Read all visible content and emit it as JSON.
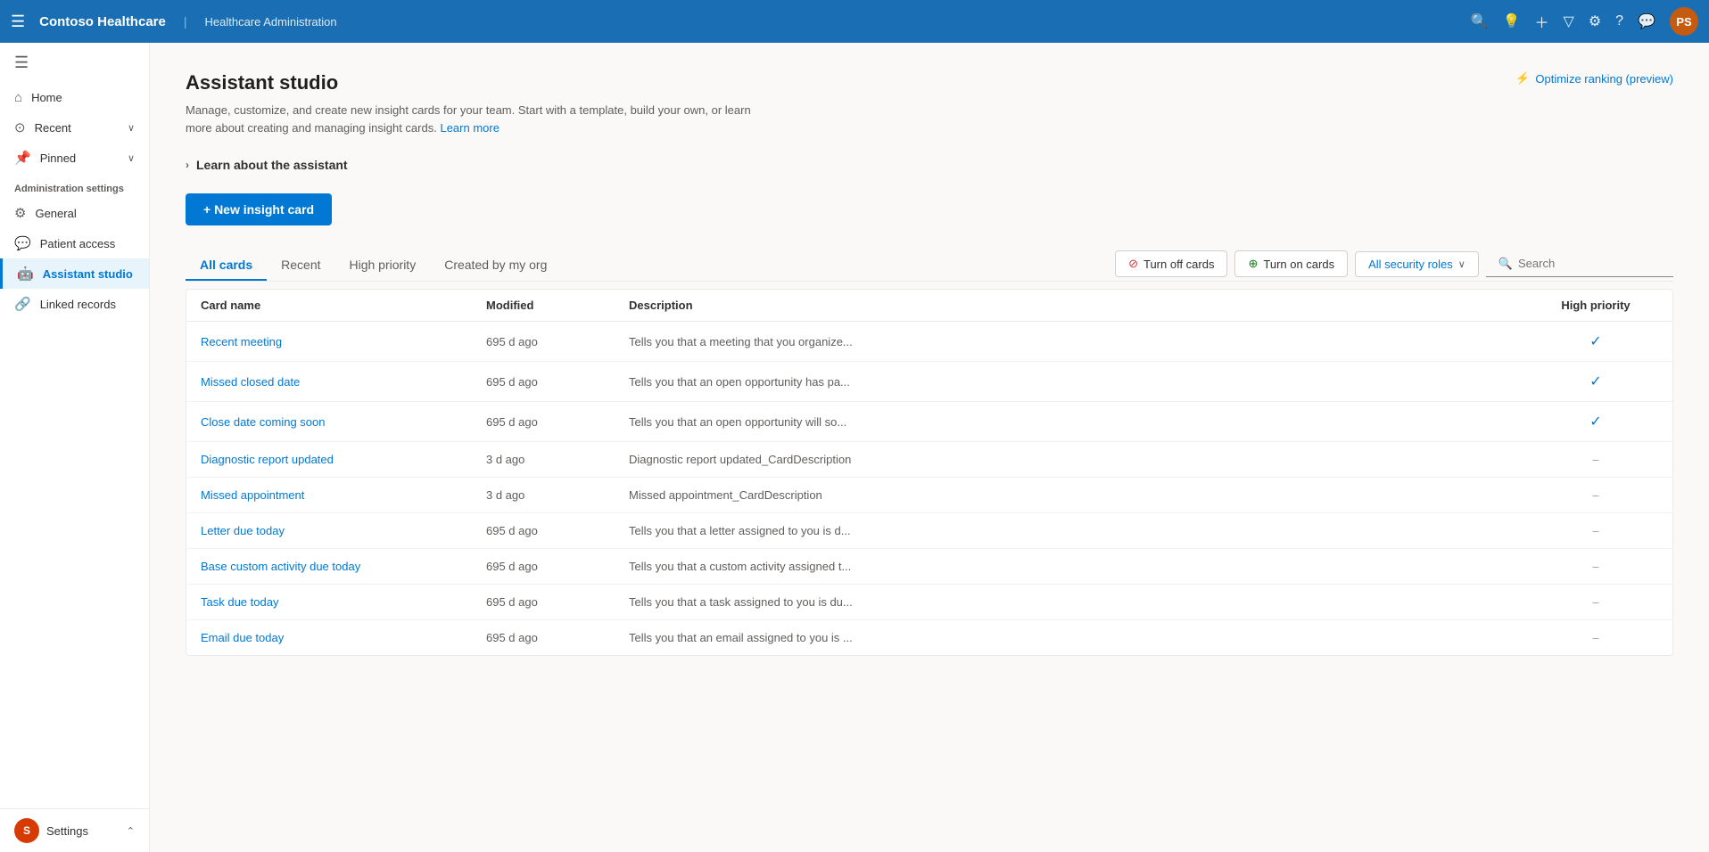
{
  "topbar": {
    "app_name": "Contoso Healthcare",
    "divider": "|",
    "subtitle": "Healthcare Administration",
    "icons": [
      "search",
      "lightbulb",
      "plus",
      "filter",
      "gear",
      "help",
      "chat"
    ],
    "avatar_initials": "PS",
    "avatar_bg": "#c55a11"
  },
  "sidebar": {
    "hamburger": "≡",
    "items": [
      {
        "id": "home",
        "label": "Home",
        "icon": "⌂"
      },
      {
        "id": "recent",
        "label": "Recent",
        "icon": "⊙",
        "chevron": "∨"
      },
      {
        "id": "pinned",
        "label": "Pinned",
        "icon": "📌",
        "chevron": "∨"
      }
    ],
    "section_label": "Administration settings",
    "admin_items": [
      {
        "id": "general",
        "label": "General",
        "icon": "⚙"
      },
      {
        "id": "patient-access",
        "label": "Patient access",
        "icon": "💬"
      },
      {
        "id": "assistant-studio",
        "label": "Assistant studio",
        "icon": "🤖",
        "active": true
      },
      {
        "id": "linked-records",
        "label": "Linked records",
        "icon": "🔗"
      }
    ],
    "footer": {
      "initials": "S",
      "label": "Settings",
      "chevron": "⌃"
    }
  },
  "page": {
    "title": "Assistant studio",
    "description": "Manage, customize, and create new insight cards for your team. Start with a template, build your own, or learn more about creating and managing insight cards.",
    "learn_more_text": "Learn more",
    "optimize_label": "Optimize ranking (preview)",
    "learn_section_label": "Learn about the assistant",
    "new_card_btn": "+ New insight card"
  },
  "tabs": [
    {
      "id": "all-cards",
      "label": "All cards",
      "active": true
    },
    {
      "id": "recent",
      "label": "Recent"
    },
    {
      "id": "high-priority",
      "label": "High priority"
    },
    {
      "id": "created-by-org",
      "label": "Created by my org"
    }
  ],
  "filters": {
    "turn_off": "Turn off cards",
    "turn_on": "Turn on cards",
    "security_roles": "All security roles",
    "search_placeholder": "Search"
  },
  "table": {
    "columns": [
      "Card name",
      "Modified",
      "Description",
      "High priority"
    ],
    "rows": [
      {
        "name": "Recent meeting",
        "modified": "695 d ago",
        "description": "Tells you that a meeting that you organize...",
        "priority": "check"
      },
      {
        "name": "Missed closed date",
        "modified": "695 d ago",
        "description": "Tells you that an open opportunity has pa...",
        "priority": "check"
      },
      {
        "name": "Close date coming soon",
        "modified": "695 d ago",
        "description": "Tells you that an open opportunity will so...",
        "priority": "check"
      },
      {
        "name": "Diagnostic report updated",
        "modified": "3 d ago",
        "description": "Diagnostic report updated_CardDescription",
        "priority": "dash"
      },
      {
        "name": "Missed appointment",
        "modified": "3 d ago",
        "description": "Missed appointment_CardDescription",
        "priority": "dash"
      },
      {
        "name": "Letter due today",
        "modified": "695 d ago",
        "description": "Tells you that a letter assigned to you is d...",
        "priority": "dash"
      },
      {
        "name": "Base custom activity due today",
        "modified": "695 d ago",
        "description": "Tells you that a custom activity assigned t...",
        "priority": "dash"
      },
      {
        "name": "Task due today",
        "modified": "695 d ago",
        "description": "Tells you that a task assigned to you is du...",
        "priority": "dash"
      },
      {
        "name": "Email due today",
        "modified": "695 d ago",
        "description": "Tells you that an email assigned to you is ...",
        "priority": "dash"
      }
    ]
  }
}
